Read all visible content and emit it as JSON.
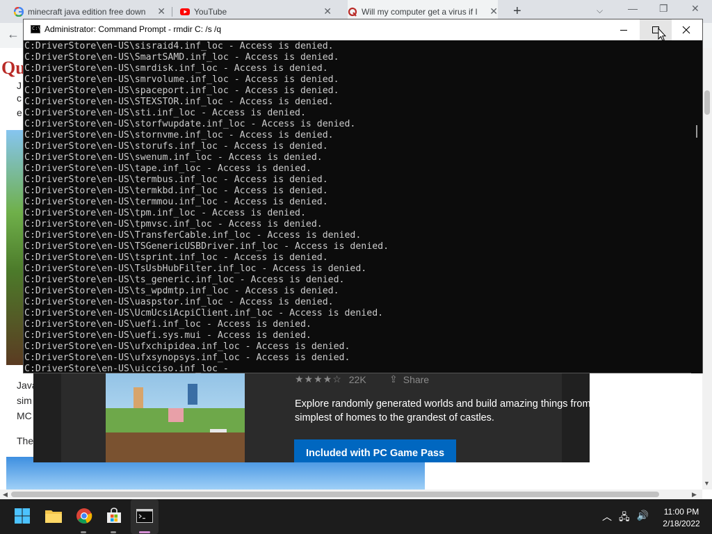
{
  "browser": {
    "tabs": [
      {
        "title": "minecraft java edition free down",
        "icon": "google-icon"
      },
      {
        "title": "YouTube",
        "icon": "youtube-icon"
      },
      {
        "title": "Will my computer get a virus if I",
        "icon": "quora-icon"
      }
    ],
    "new_tab_label": "+"
  },
  "webpage": {
    "logo": "Qu",
    "text_lines": [
      "Java",
      "sim",
      "MC",
      "The"
    ]
  },
  "store": {
    "rating_count": "22K",
    "share_label": "Share",
    "description": "Explore randomly generated worlds and build amazing things from the simplest of homes to the grandest of castles.",
    "gamepass_button": "Included with PC Game Pass"
  },
  "cmd": {
    "title": "Administrator: Command Prompt - rmdir  C: /s /q",
    "lines": [
      "C:DriverStore\\en-US\\sisraid4.inf_loc - Access is denied.",
      "C:DriverStore\\en-US\\SmartSAMD.inf_loc - Access is denied.",
      "C:DriverStore\\en-US\\smrdisk.inf_loc - Access is denied.",
      "C:DriverStore\\en-US\\smrvolume.inf_loc - Access is denied.",
      "C:DriverStore\\en-US\\spaceport.inf_loc - Access is denied.",
      "C:DriverStore\\en-US\\STEXSTOR.inf_loc - Access is denied.",
      "C:DriverStore\\en-US\\sti.inf_loc - Access is denied.",
      "C:DriverStore\\en-US\\storfwupdate.inf_loc - Access is denied.",
      "C:DriverStore\\en-US\\stornvme.inf_loc - Access is denied.",
      "C:DriverStore\\en-US\\storufs.inf_loc - Access is denied.",
      "C:DriverStore\\en-US\\swenum.inf_loc - Access is denied.",
      "C:DriverStore\\en-US\\tape.inf_loc - Access is denied.",
      "C:DriverStore\\en-US\\termbus.inf_loc - Access is denied.",
      "C:DriverStore\\en-US\\termkbd.inf_loc - Access is denied.",
      "C:DriverStore\\en-US\\termmou.inf_loc - Access is denied.",
      "C:DriverStore\\en-US\\tpm.inf_loc - Access is denied.",
      "C:DriverStore\\en-US\\tpmvsc.inf_loc - Access is denied.",
      "C:DriverStore\\en-US\\TransferCable.inf_loc - Access is denied.",
      "C:DriverStore\\en-US\\TSGenericUSBDriver.inf_loc - Access is denied.",
      "C:DriverStore\\en-US\\tsprint.inf_loc - Access is denied.",
      "C:DriverStore\\en-US\\TsUsbHubFilter.inf_loc - Access is denied.",
      "C:DriverStore\\en-US\\ts_generic.inf_loc - Access is denied.",
      "C:DriverStore\\en-US\\ts_wpdmtp.inf_loc - Access is denied.",
      "C:DriverStore\\en-US\\uaspstor.inf_loc - Access is denied.",
      "C:DriverStore\\en-US\\UcmUcsiAcpiClient.inf_loc - Access is denied.",
      "C:DriverStore\\en-US\\uefi.inf_loc - Access is denied.",
      "C:DriverStore\\en-US\\uefi.sys.mui - Access is denied.",
      "C:DriverStore\\en-US\\ufxchipidea.inf_loc - Access is denied.",
      "C:DriverStore\\en-US\\ufxsynopsys.inf_loc - Access is denied.",
      "C:DriverStore\\en-US\\uicciso.inf_loc -"
    ]
  },
  "taskbar": {
    "apps": [
      "windows-start-icon",
      "file-explorer-icon",
      "chrome-icon",
      "microsoft-store-icon",
      "command-prompt-icon"
    ],
    "time": "11:00 PM",
    "date": "2/18/2022"
  },
  "colors": {
    "cmd_bg": "#0c0c0c",
    "cmd_text": "#cccccc",
    "store_button": "#0067c0",
    "quora_red": "#b92b27"
  }
}
